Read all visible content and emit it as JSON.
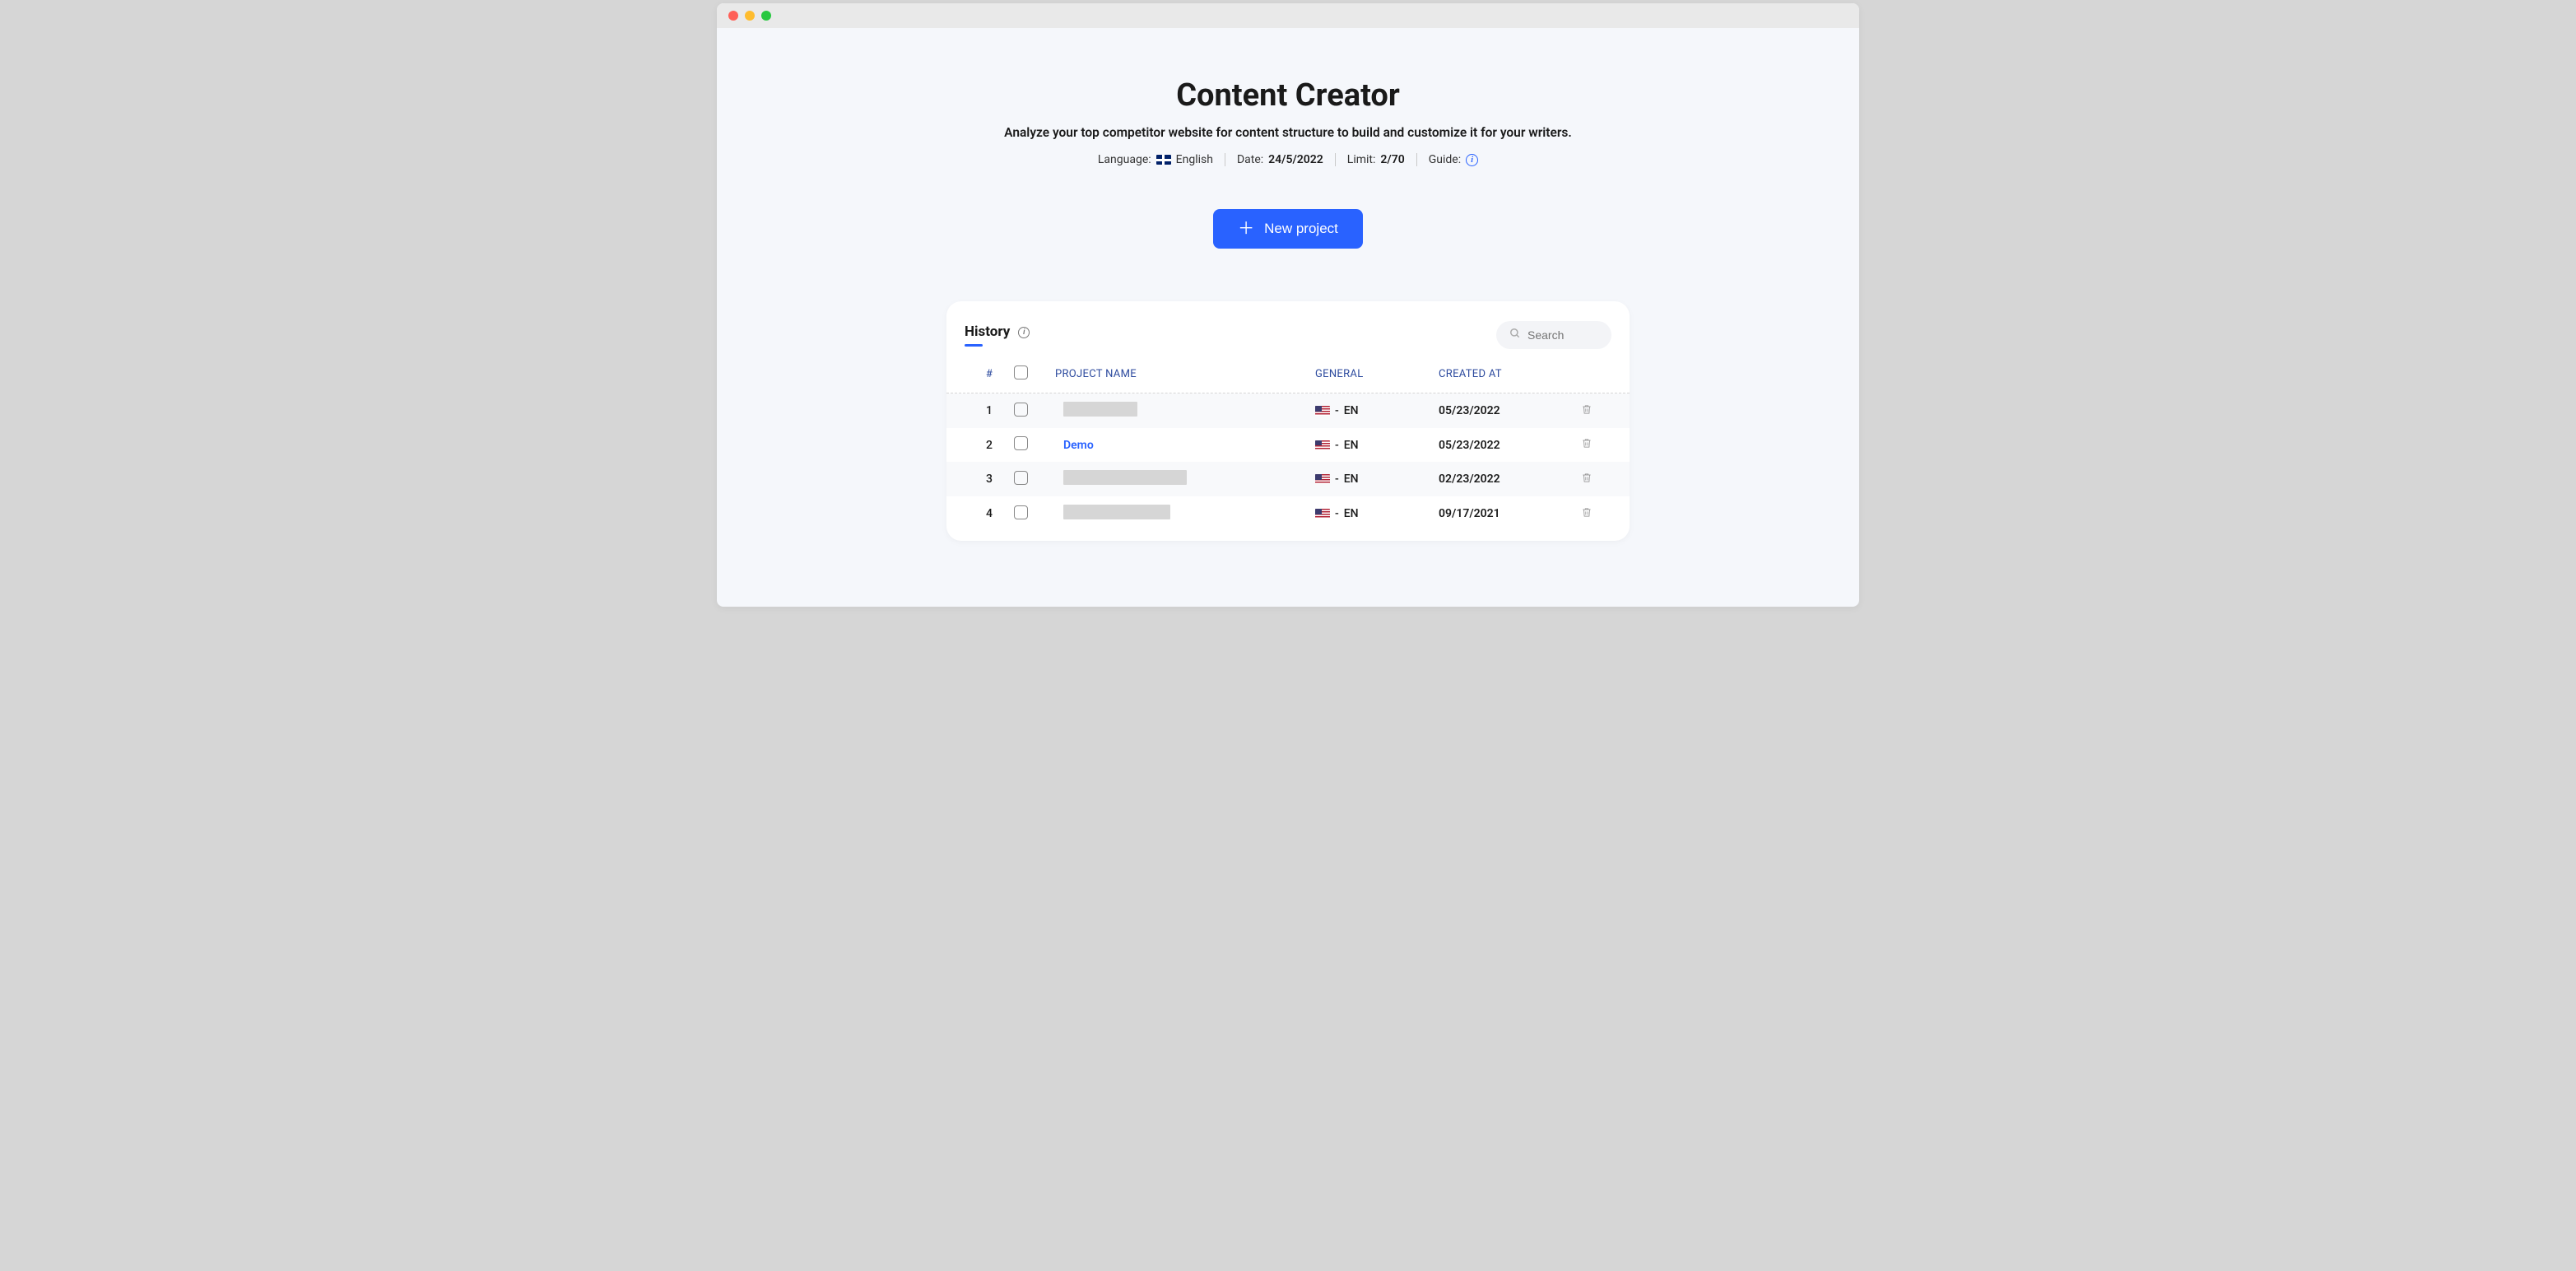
{
  "header": {
    "title": "Content Creator",
    "subtitle": "Analyze your top competitor website for content structure to build and customize it for your writers.",
    "meta": {
      "language_label": "Language:",
      "language_value": "English",
      "date_label": "Date:",
      "date_value": "24/5/2022",
      "limit_label": "Limit:",
      "limit_value": "2/70",
      "guide_label": "Guide:"
    },
    "new_project_label": "New project"
  },
  "history": {
    "title": "History",
    "search_placeholder": "Search",
    "columns": {
      "num": "#",
      "name": "PROJECT NAME",
      "general": "GENERAL",
      "created": "CREATED AT"
    },
    "rows": [
      {
        "num": "1",
        "name": "",
        "redacted": true,
        "redact_class": "redacted-90",
        "general_sep": "-",
        "general_code": "EN",
        "created": "05/23/2022"
      },
      {
        "num": "2",
        "name": "Demo",
        "redacted": false,
        "general_sep": "-",
        "general_code": "EN",
        "created": "05/23/2022"
      },
      {
        "num": "3",
        "name": "",
        "redacted": true,
        "redact_class": "redacted-150",
        "general_sep": "-",
        "general_code": "EN",
        "created": "02/23/2022"
      },
      {
        "num": "4",
        "name": "",
        "redacted": true,
        "redact_class": "redacted-130",
        "general_sep": "-",
        "general_code": "EN",
        "created": "09/17/2021"
      }
    ]
  }
}
